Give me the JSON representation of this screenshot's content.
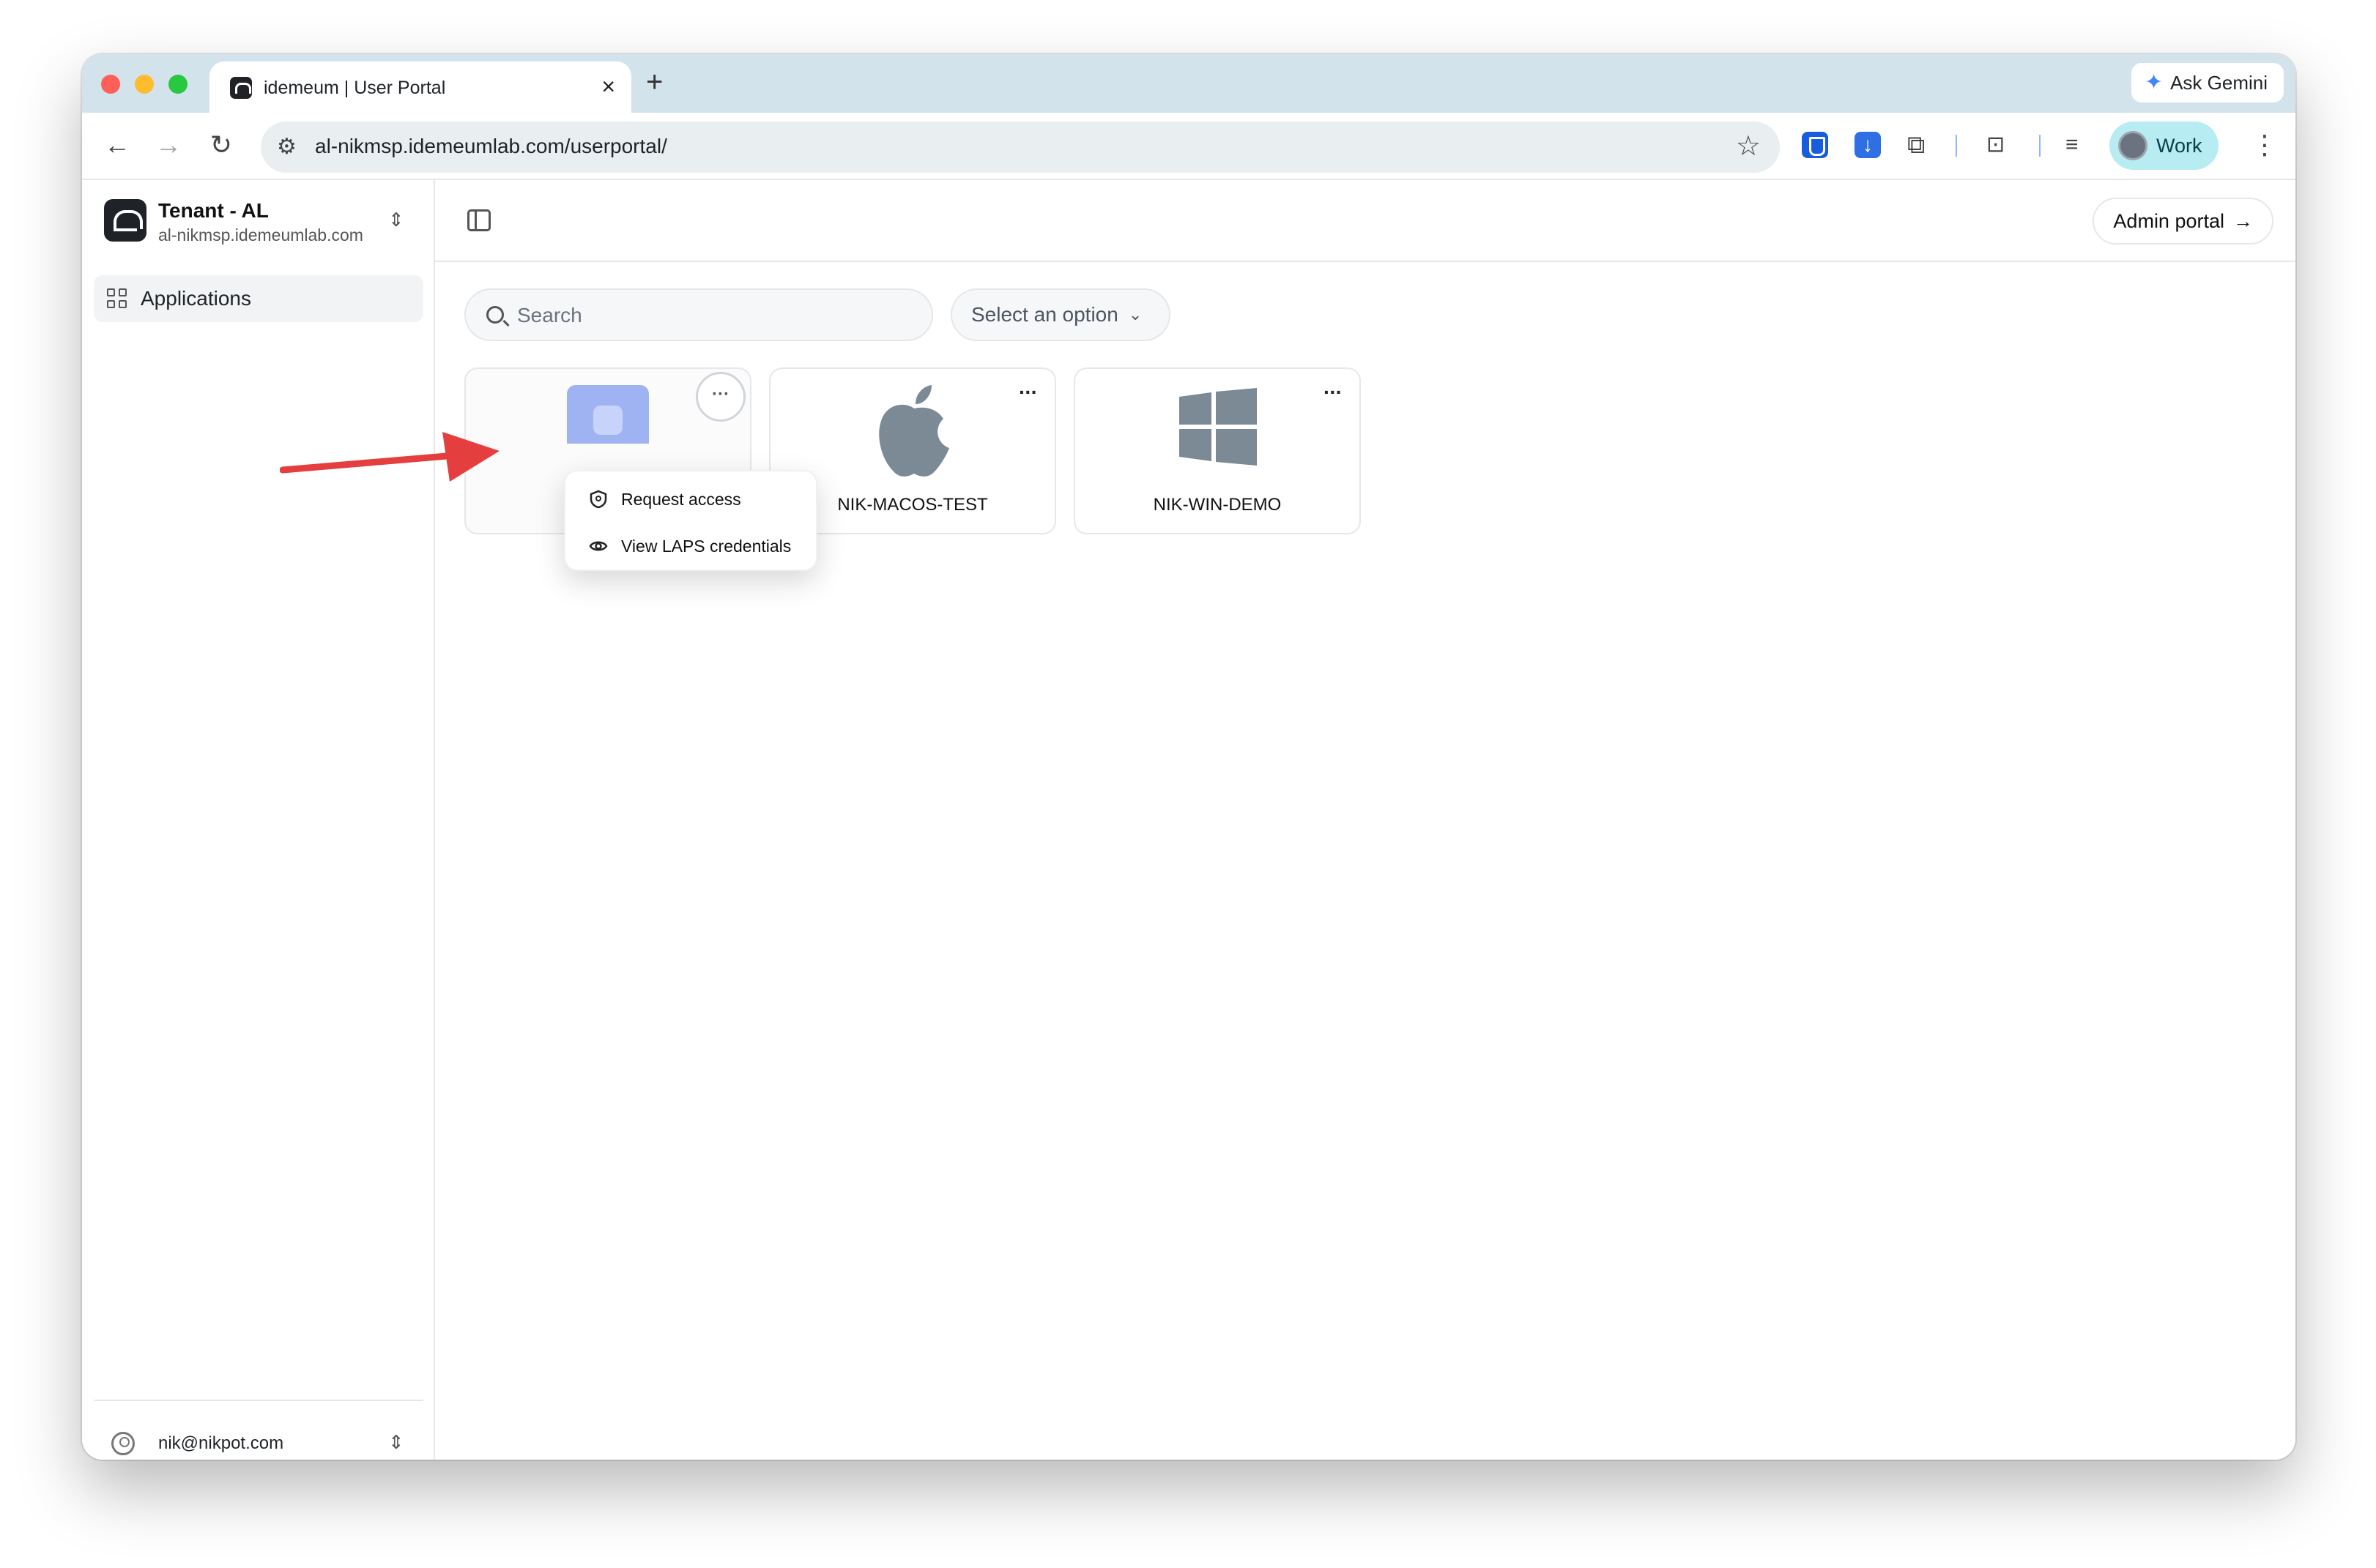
{
  "browser": {
    "tab_title": "idemeum | User Portal",
    "tab_close": "×",
    "new_tab": "+",
    "ask_gemini": "Ask Gemini",
    "url": "al-nikmsp.idemeumlab.com/userportal/",
    "profile_label": "Work"
  },
  "sidebar": {
    "tenant_name": "Tenant - AL",
    "tenant_domain": "al-nikmsp.idemeumlab.com",
    "items": [
      {
        "label": "Applications",
        "icon": "grid-icon",
        "active": true
      }
    ],
    "user_email": "nik@nikpot.com"
  },
  "header": {
    "admin_portal_label": "Admin portal",
    "admin_portal_arrow": "→"
  },
  "filters": {
    "search_placeholder": "Search",
    "select_label": "Select an option"
  },
  "cards": [
    {
      "label": "",
      "icon": "app-icon",
      "more": "···"
    },
    {
      "label": "NIK-MACOS-TEST",
      "icon": "apple-icon",
      "more": "···"
    },
    {
      "label": "NIK-WIN-DEMO",
      "icon": "windows-icon",
      "more": "···"
    }
  ],
  "context_menu": {
    "items": [
      {
        "label": "Request access",
        "icon": "shield-icon"
      },
      {
        "label": "View LAPS credentials",
        "icon": "eye-icon"
      }
    ]
  },
  "colors": {
    "tabstrip": "#d3e3ec",
    "profile_chip": "#b6ecf2",
    "annotation_arrow": "#e53e3e",
    "os_logo": "#7b8a95"
  }
}
